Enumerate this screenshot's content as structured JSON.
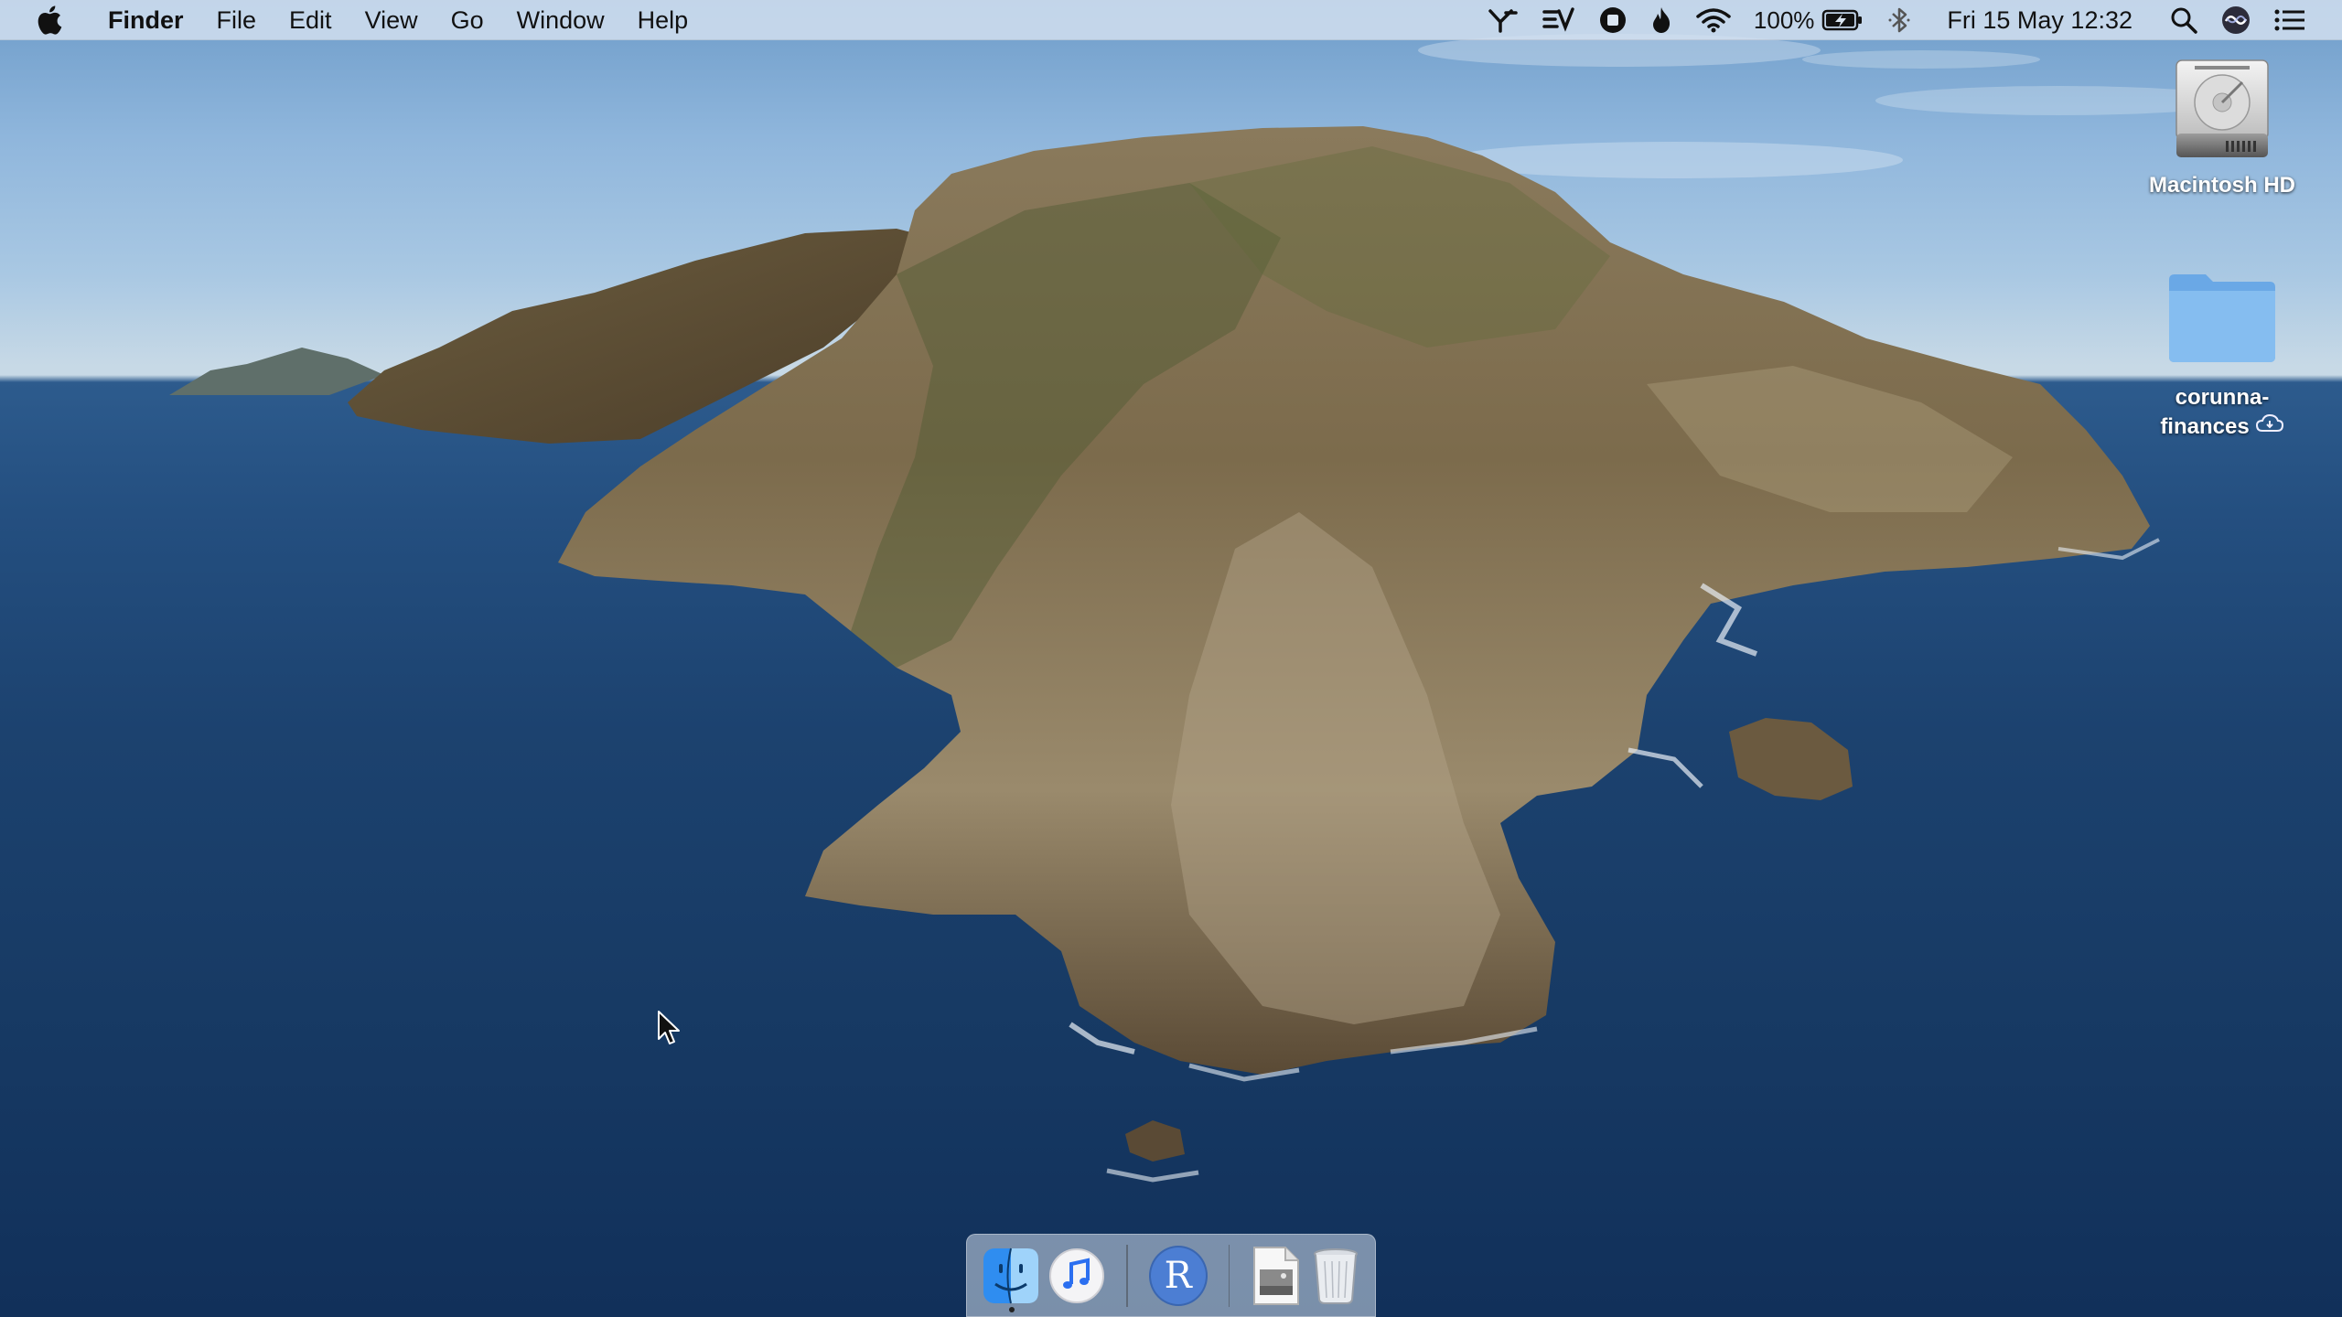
{
  "menubar": {
    "app_name": "Finder",
    "menus": [
      "File",
      "Edit",
      "View",
      "Go",
      "Window",
      "Help"
    ],
    "battery_percent": "100%",
    "datetime": "Fri 15 May  12:32",
    "status_icons": [
      "y-app-icon",
      "ev-app-icon",
      "stop-record-icon",
      "flame-icon",
      "wifi-icon",
      "battery-charging-icon",
      "bluetooth-icon",
      "spotlight-search-icon",
      "siri-icon",
      "notification-center-icon"
    ]
  },
  "desktop": {
    "icons": [
      {
        "label": "Macintosh HD",
        "icon": "hard-drive-icon"
      },
      {
        "label_line1": "corunna-",
        "label_line2": "finances",
        "icon": "folder-icon",
        "badge": "icloud-icon"
      }
    ]
  },
  "dock": {
    "items": [
      "finder-icon",
      "music-icon",
      "r-app-icon",
      "preview-document-icon",
      "trash-icon"
    ],
    "r_label": "R"
  }
}
